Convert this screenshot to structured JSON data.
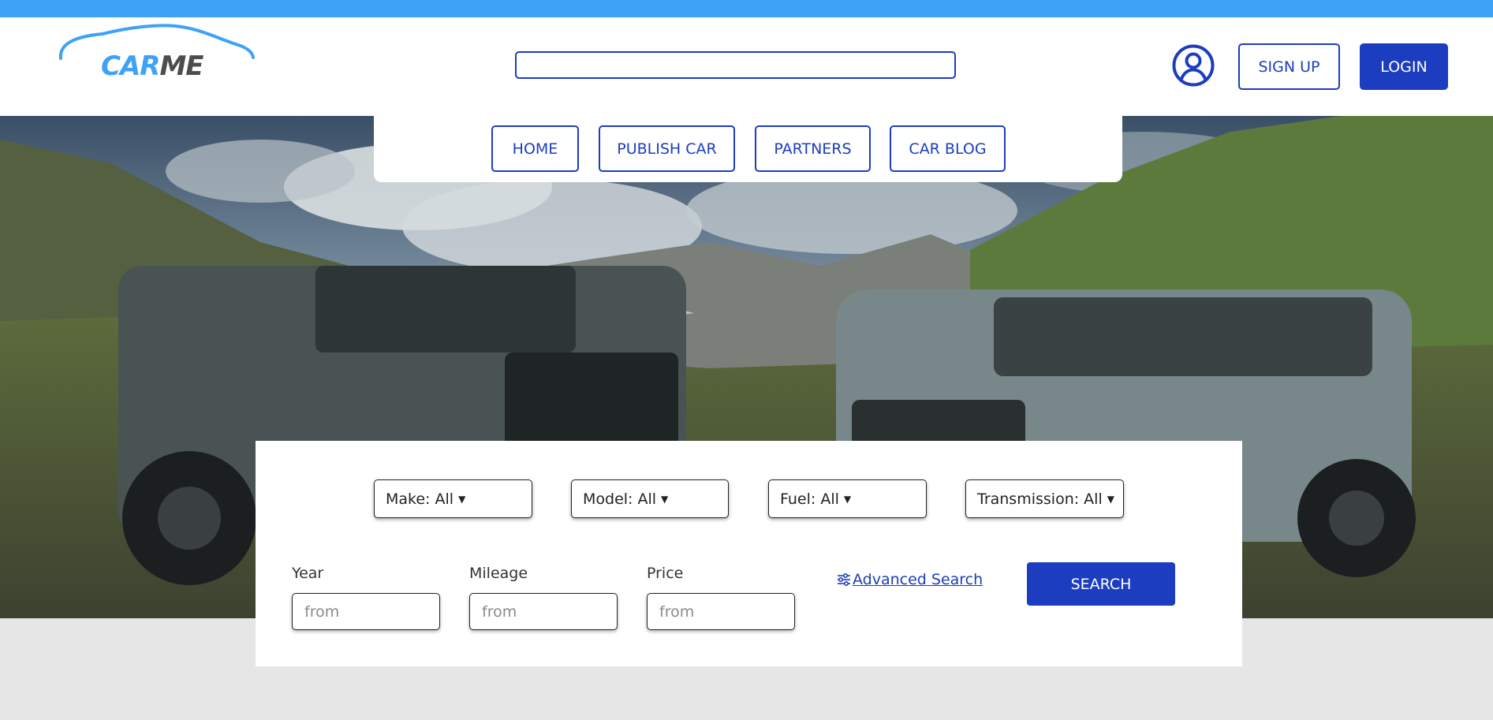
{
  "brand": {
    "logo_car": "CAR",
    "logo_me": "ME",
    "primary_color": "#1c3dbf",
    "accent_color": "#3ea2f7"
  },
  "header": {
    "search": {
      "value": "",
      "placeholder": ""
    },
    "user_icon": "user-circle-icon",
    "signup_label": "SIGN UP",
    "login_label": "LOGIN"
  },
  "nav": {
    "items": [
      {
        "label": "HOME"
      },
      {
        "label": "PUBLISH CAR"
      },
      {
        "label": "PARTNERS"
      },
      {
        "label": "CAR BLOG"
      }
    ]
  },
  "filters": {
    "make": "Make: All",
    "model": "Model: All",
    "fuel": "Fuel: All",
    "transmission": "Transmission: All",
    "caret_icon": "caret-down-icon"
  },
  "range_fields": {
    "year": {
      "label": "Year",
      "placeholder": "from",
      "value": ""
    },
    "mileage": {
      "label": "Mileage",
      "placeholder": "from",
      "value": ""
    },
    "price": {
      "label": "Price",
      "placeholder": "from",
      "value": ""
    }
  },
  "advanced_search": {
    "label": "Advanced Search",
    "icon": "sliders-icon"
  },
  "search_button": {
    "label": "SEARCH"
  }
}
